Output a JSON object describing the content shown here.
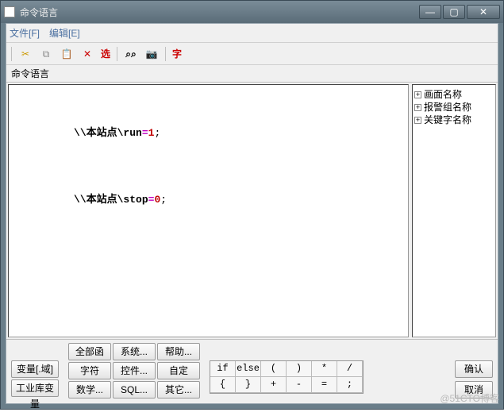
{
  "titlebar": {
    "title": "命令语言"
  },
  "menubar": {
    "file": "文件[F]",
    "edit": "编辑[E]"
  },
  "toolbar": {
    "select_label": "选",
    "font_label": "字"
  },
  "panel": {
    "label": "命令语言"
  },
  "code": {
    "lines": [
      {
        "prefix": "\\\\本站点\\",
        "name": "run",
        "eq": "=",
        "val": "1",
        "end": ";"
      },
      {
        "prefix": "\\\\本站点\\",
        "name": "stop",
        "eq": "=",
        "val": "0",
        "end": ";"
      }
    ]
  },
  "tree": {
    "items": [
      "画面名称",
      "报警组名称",
      "关键字名称"
    ]
  },
  "buttons": {
    "var_domain": "变量[.域]",
    "industry_var": "工业库变量",
    "all_funcs": "全部函数",
    "string_funcs": "字符串...",
    "math_funcs": "数学...",
    "system": "系统...",
    "controls": "控件...",
    "sql": "SQL...",
    "help": "帮助...",
    "custom": "自定义...",
    "other": "其它...",
    "ok": "确认",
    "cancel": "取消"
  },
  "operators": {
    "row1": [
      "if",
      "else",
      "(",
      ")",
      "*",
      "/"
    ],
    "row2": [
      "{",
      "}",
      "+",
      "-",
      "=",
      ";"
    ]
  },
  "watermark": "@51CTO博客"
}
